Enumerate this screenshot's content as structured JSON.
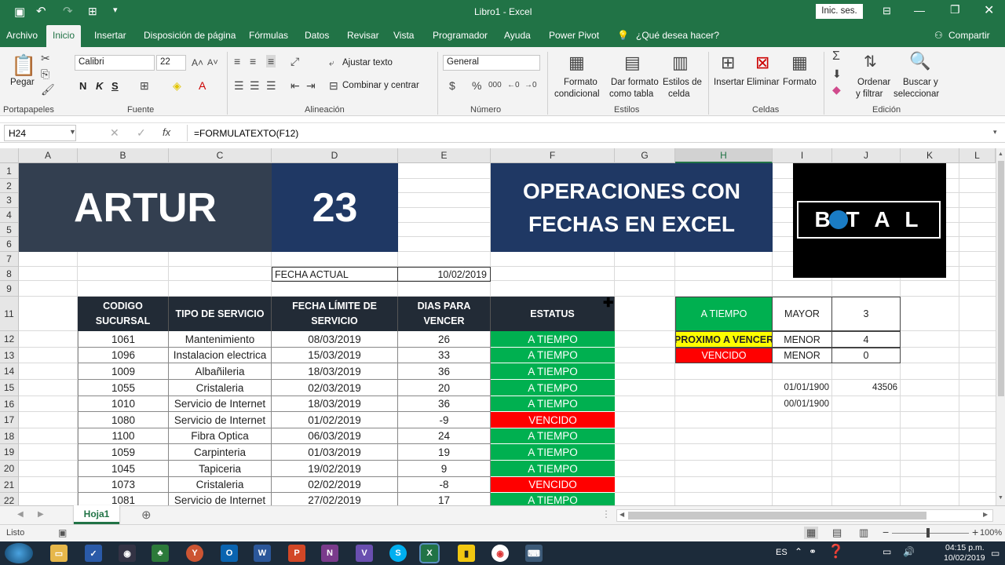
{
  "titlebar": {
    "title": "Libro1  -  Excel",
    "signin": "Inic. ses."
  },
  "menu": {
    "items": [
      "Archivo",
      "Inicio",
      "Insertar",
      "Disposición de página",
      "Fórmulas",
      "Datos",
      "Revisar",
      "Vista",
      "Programador",
      "Ayuda",
      "Power Pivot"
    ],
    "tell_me": "¿Qué desea hacer?",
    "share": "Compartir"
  },
  "ribbon": {
    "paste": "Pegar",
    "font_name": "Calibri",
    "font_size": "22",
    "bold": "N",
    "italic": "K",
    "underline": "S",
    "wrap_text": "Ajustar texto",
    "merge_center": "Combinar y centrar",
    "number_format": "General",
    "cond_format": [
      "Formato",
      "condicional"
    ],
    "format_table": [
      "Dar formato",
      "como tabla"
    ],
    "cell_styles": [
      "Estilos de",
      "celda"
    ],
    "insert": "Insertar",
    "delete": "Eliminar",
    "format": "Formato",
    "sort_filter": [
      "Ordenar",
      "y filtrar"
    ],
    "find_select": [
      "Buscar y",
      "seleccionar"
    ],
    "groups": [
      "Portapapeles",
      "Fuente",
      "Alineación",
      "Número",
      "Estilos",
      "Celdas",
      "Edición"
    ]
  },
  "formula_bar": {
    "name_box": "H24",
    "formula": "=FORMULATEXTO(F12)"
  },
  "columns": [
    "A",
    "B",
    "C",
    "D",
    "E",
    "F",
    "G",
    "H",
    "I",
    "J",
    "K",
    "L"
  ],
  "rows": [
    "1",
    "2",
    "3",
    "4",
    "5",
    "6",
    "7",
    "8",
    "9",
    "11",
    "12",
    "13",
    "14",
    "15",
    "16",
    "17",
    "18",
    "19",
    "20",
    "21",
    "22"
  ],
  "sheet": {
    "banner_name": "ARTUR",
    "banner_number": "23",
    "banner_title": "OPERACIONES CON FECHAS EN EXCEL",
    "logo_text": "B  T A L",
    "fecha_actual_label": "FECHA ACTUAL",
    "fecha_actual_value": "10/02/2019",
    "headers": [
      "CODIGO SUCURSAL",
      "TIPO DE SERVICIO",
      "FECHA LÍMITE DE SERVICIO",
      "DIAS PARA VENCER",
      "ESTATUS"
    ],
    "table": [
      {
        "codigo": "1061",
        "tipo": "Mantenimiento",
        "fecha": "08/03/2019",
        "dias": "26",
        "estatus": "A TIEMPO"
      },
      {
        "codigo": "1096",
        "tipo": "Instalacion electrica",
        "fecha": "15/03/2019",
        "dias": "33",
        "estatus": "A TIEMPO"
      },
      {
        "codigo": "1009",
        "tipo": "Albañileria",
        "fecha": "18/03/2019",
        "dias": "36",
        "estatus": "A TIEMPO"
      },
      {
        "codigo": "1055",
        "tipo": "Cristaleria",
        "fecha": "02/03/2019",
        "dias": "20",
        "estatus": "A TIEMPO"
      },
      {
        "codigo": "1010",
        "tipo": "Servicio de Internet",
        "fecha": "18/03/2019",
        "dias": "36",
        "estatus": "A TIEMPO"
      },
      {
        "codigo": "1080",
        "tipo": "Servicio de Internet",
        "fecha": "01/02/2019",
        "dias": "-9",
        "estatus": "VENCIDO"
      },
      {
        "codigo": "1100",
        "tipo": "Fibra Optica",
        "fecha": "06/03/2019",
        "dias": "24",
        "estatus": "A TIEMPO"
      },
      {
        "codigo": "1059",
        "tipo": "Carpinteria",
        "fecha": "01/03/2019",
        "dias": "19",
        "estatus": "A TIEMPO"
      },
      {
        "codigo": "1045",
        "tipo": "Tapiceria",
        "fecha": "19/02/2019",
        "dias": "9",
        "estatus": "A TIEMPO"
      },
      {
        "codigo": "1073",
        "tipo": "Cristaleria",
        "fecha": "02/02/2019",
        "dias": "-8",
        "estatus": "VENCIDO"
      },
      {
        "codigo": "1081",
        "tipo": "Servicio de Internet",
        "fecha": "27/02/2019",
        "dias": "17",
        "estatus": "A TIEMPO"
      }
    ],
    "legend": [
      {
        "label": "A TIEMPO",
        "cond": "MAYOR",
        "val": "3"
      },
      {
        "label": "PROXIMO A VENCER",
        "cond": "MENOR",
        "val": "4"
      },
      {
        "label": "VENCIDO",
        "cond": "MENOR",
        "val": "0"
      }
    ],
    "extra": {
      "i15": "01/01/1900",
      "j15": "43506",
      "i16": "00/01/1900"
    }
  },
  "sheet_tab": "Hoja1",
  "status": {
    "ready": "Listo",
    "zoom": "100%"
  },
  "taskbar": {
    "lang": "ES",
    "time": "04:15 p.m.",
    "date": "10/02/2019"
  },
  "colors": {
    "excel_green": "#217346",
    "banner": "#1f3864",
    "header": "#222b36",
    "ok": "#00b050",
    "due": "#ff0000",
    "warn": "#ffff00"
  }
}
